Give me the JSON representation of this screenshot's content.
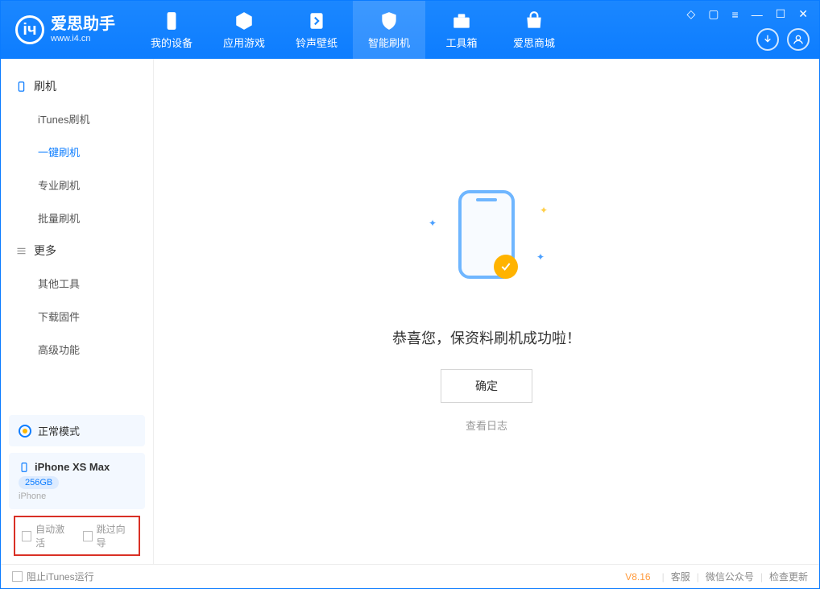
{
  "app": {
    "name": "爱思助手",
    "url": "www.i4.cn"
  },
  "nav": {
    "items": [
      {
        "label": "我的设备"
      },
      {
        "label": "应用游戏"
      },
      {
        "label": "铃声壁纸"
      },
      {
        "label": "智能刷机"
      },
      {
        "label": "工具箱"
      },
      {
        "label": "爱思商城"
      }
    ],
    "active_index": 3
  },
  "sidebar": {
    "group1": {
      "title": "刷机",
      "items": [
        "iTunes刷机",
        "一键刷机",
        "专业刷机",
        "批量刷机"
      ],
      "active_index": 1
    },
    "group2": {
      "title": "更多",
      "items": [
        "其他工具",
        "下载固件",
        "高级功能"
      ]
    }
  },
  "mode": {
    "label": "正常模式"
  },
  "device": {
    "name": "iPhone XS Max",
    "storage": "256GB",
    "type": "iPhone"
  },
  "checkboxes": {
    "auto_activate": "自动激活",
    "skip_guide": "跳过向导"
  },
  "main": {
    "success_message": "恭喜您，保资料刷机成功啦！",
    "confirm_label": "确定",
    "log_link": "查看日志"
  },
  "footer": {
    "block_itunes": "阻止iTunes运行",
    "version": "V8.16",
    "links": [
      "客服",
      "微信公众号",
      "检查更新"
    ]
  }
}
